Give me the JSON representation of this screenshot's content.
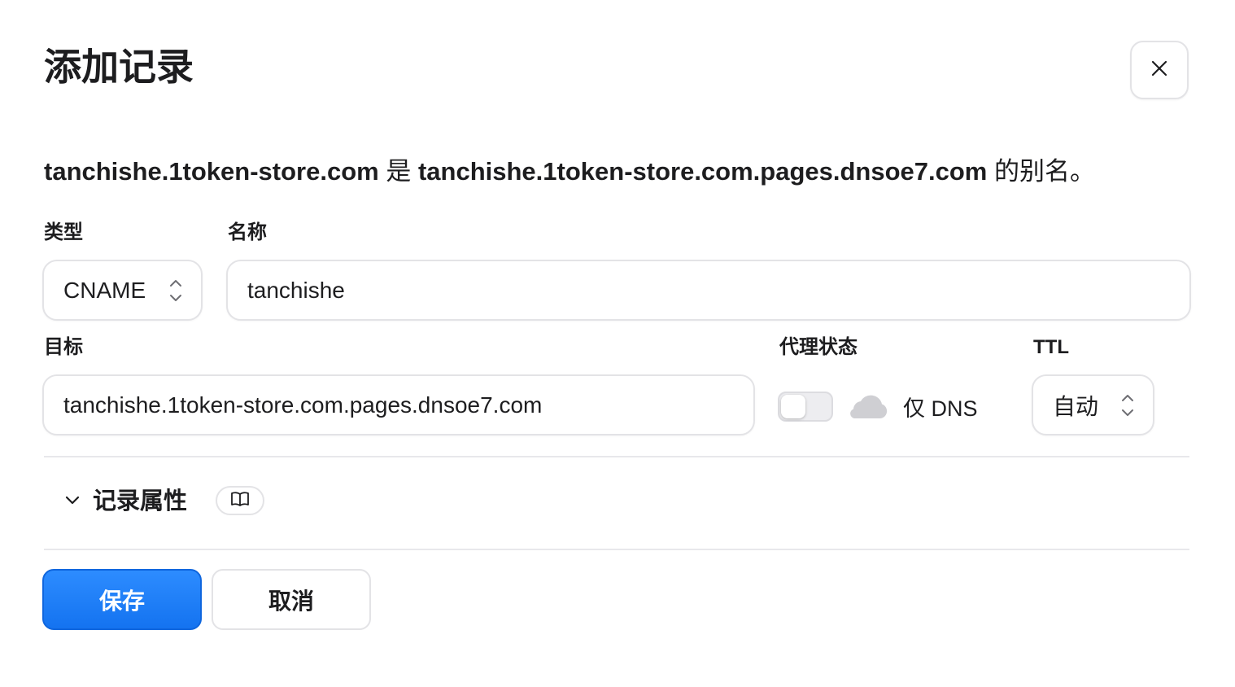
{
  "dialog": {
    "title": "添加记录",
    "close_icon": "close-icon"
  },
  "description": {
    "name": "tanchishe.1token-store.com",
    "is_text": " 是 ",
    "target": "tanchishe.1token-store.com.pages.dnsoe7.com",
    "suffix": " 的别名。"
  },
  "form": {
    "type_label": "类型",
    "type_value": "CNAME",
    "name_label": "名称",
    "name_value": "tanchishe",
    "target_label": "目标",
    "target_value": "tanchishe.1token-store.com.pages.dnsoe7.com",
    "proxy_label": "代理状态",
    "proxy_enabled": false,
    "proxy_text": "仅 DNS",
    "ttl_label": "TTL",
    "ttl_value": "自动"
  },
  "record_attributes": {
    "label": "记录属性",
    "expanded": true,
    "icon": "book-icon"
  },
  "actions": {
    "save_label": "保存",
    "cancel_label": "取消"
  },
  "colors": {
    "primary": "#1a78f5",
    "border": "#e3e3e6",
    "text": "#1d1d1f",
    "cloud_gray": "#cfcfd3"
  }
}
